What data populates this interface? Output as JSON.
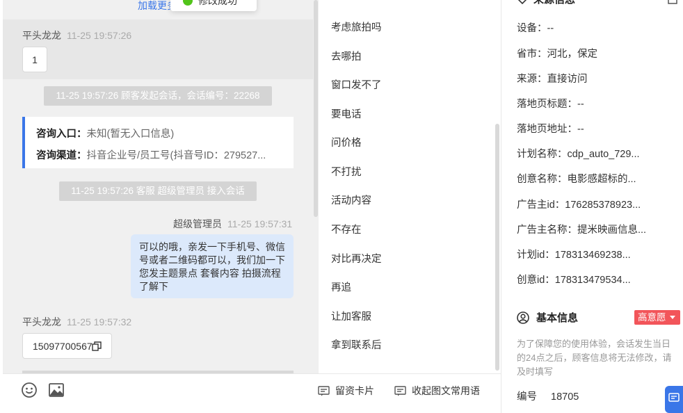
{
  "chat": {
    "load_more": "加载更多",
    "toast": "修改成功",
    "messages": [
      {
        "sender": "平头龙龙",
        "time": "11-25 19:57:26",
        "text": "1"
      },
      {
        "sender": "超级管理员",
        "time": "11-25 19:57:31",
        "text": "可以的哦，亲发一下手机号、微信号或者二维码都可以，我们加一下您发主题景点 套餐内容 拍摄流程了解下"
      },
      {
        "sender": "平头龙龙",
        "time": "11-25 19:57:32",
        "text": "15097700567"
      }
    ],
    "system": [
      "11-25 19:57:26 顾客发起会话，会话编号：22268",
      "11-25 19:57:26 客服 超级管理员 接入会话"
    ],
    "entry": {
      "label1": "咨询入口：",
      "value1": "未知(暂无入口信息)",
      "label2": "咨询渠道：",
      "value2": "抖音企业号/员工号(抖音号ID：279527..."
    }
  },
  "toolbar": {
    "card_label": "留资卡片",
    "collapse_label": "收起图文常用语"
  },
  "quick_replies": [
    "考虑旅拍吗",
    "去哪拍",
    "窗口发不了",
    "要电话",
    "问价格",
    "不打扰",
    "活动内容",
    "不存在",
    "对比再决定",
    "再追",
    "让加客服",
    "拿到联系后"
  ],
  "info": {
    "source_title": "来源信息",
    "fields": [
      {
        "label": "设备：",
        "value": "--"
      },
      {
        "label": "省市：",
        "value": "河北，保定"
      },
      {
        "label": "来源：",
        "value": "直接访问"
      },
      {
        "label": "落地页标题：",
        "value": "--"
      },
      {
        "label": "落地页地址：",
        "value": "--"
      },
      {
        "label": "计划名称：",
        "value": "cdp_auto_729..."
      },
      {
        "label": "创意名称：",
        "value": "电影感超标的..."
      },
      {
        "label": "广告主id：",
        "value": "176285378923..."
      },
      {
        "label": "广告主名称：",
        "value": "提米映画信息..."
      },
      {
        "label": "计划id：",
        "value": "178313469238..."
      },
      {
        "label": "创意id：",
        "value": "178313479534..."
      }
    ],
    "basic_title": "基本信息",
    "intent_badge": "高意愿",
    "note": "为了保障您的使用体验，会话发生当日的24点之后，顾客信息将无法修改，请及时填写",
    "number_label": "编号",
    "number_value": "18705"
  }
}
